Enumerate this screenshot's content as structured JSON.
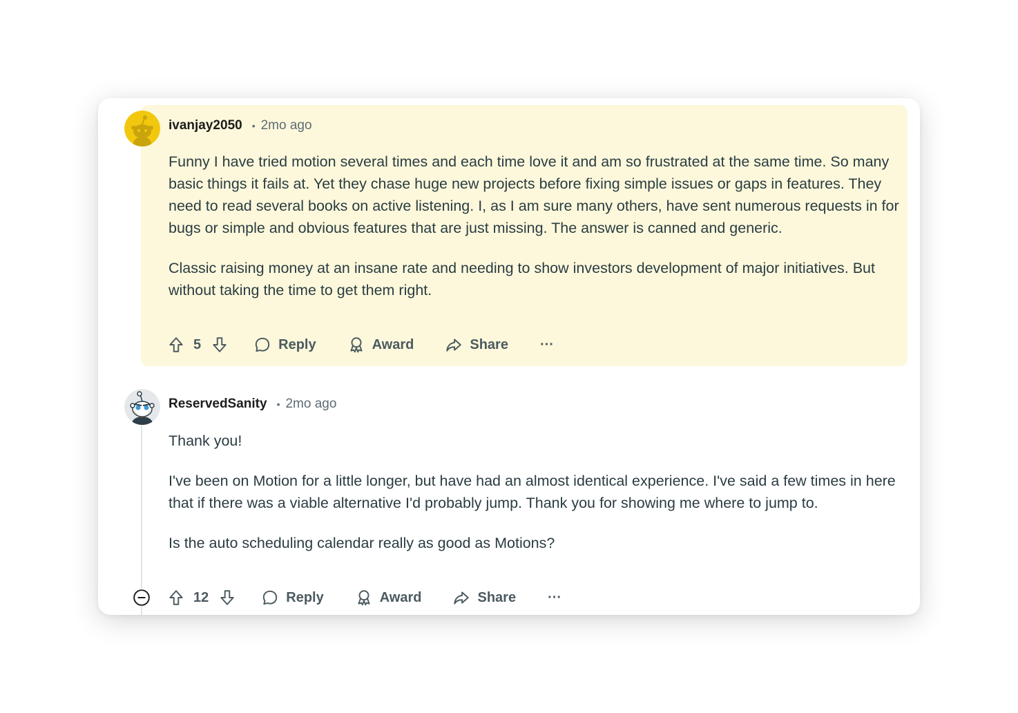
{
  "comments": [
    {
      "username": "ivanjay2050",
      "separator": "•",
      "time": "2mo ago",
      "paragraphs": [
        "Funny I have tried motion several times and each time love it and am so frustrated at the same time. So many basic things it fails at. Yet they chase huge new projects before fixing simple issues or gaps in features. They need to read several books on active listening. I, as I am sure many others, have sent numerous requests in for bugs or simple and obvious features that are just missing. The answer is canned and generic.",
        "Classic raising money at an insane rate and needing to show investors development of major initiatives. But without taking the time to get them right."
      ],
      "votes": "5",
      "actions": {
        "reply": "Reply",
        "award": "Award",
        "share": "Share",
        "more": "···"
      },
      "highlighted": true,
      "highlight_color": "#fdf8db",
      "avatar_icon": "snoo-avatar-yellow"
    },
    {
      "username": "ReservedSanity",
      "separator": "•",
      "time": "2mo ago",
      "paragraphs": [
        "Thank you!",
        "I've been on Motion for a little longer, but have had an almost identical experience. I've said a few times in here that if there was a viable alternative I'd probably jump. Thank you for showing me where to jump to.",
        "Is the auto scheduling calendar really as good as Motions?"
      ],
      "votes": "12",
      "actions": {
        "reply": "Reply",
        "award": "Award",
        "share": "Share",
        "more": "···"
      },
      "highlighted": false,
      "avatar_icon": "snoo-avatar-bearded"
    }
  ]
}
